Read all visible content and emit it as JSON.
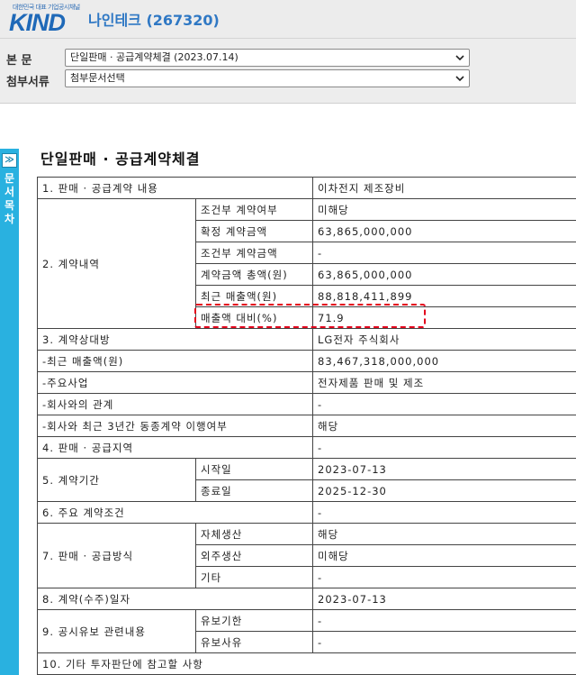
{
  "header": {
    "logo_tagline": "대한민국 대표 기업공시채널",
    "logo_text": "KIND",
    "company": "나인테크 (267320)"
  },
  "selectors": {
    "main_label": "본 문",
    "main_value": "단일판매 · 공급계약체결 (2023.07.14)",
    "attach_label": "첨부서류",
    "attach_value": "첨부문서선택"
  },
  "sidebar": {
    "toggle": "≫",
    "label": "문서목차"
  },
  "doc": {
    "title": "단일판매 · 공급계약체결",
    "r1": {
      "label": "1. 판매 · 공급계약 내용",
      "value": "이차전지 제조장비"
    },
    "r2": {
      "label": "2. 계약내역",
      "items": [
        {
          "label": "조건부 계약여부",
          "value": "미해당"
        },
        {
          "label": "확정 계약금액",
          "value": "63,865,000,000"
        },
        {
          "label": "조건부 계약금액",
          "value": "-"
        },
        {
          "label": "계약금액 총액(원)",
          "value": "63,865,000,000"
        },
        {
          "label": "최근 매출액(원)",
          "value": "88,818,411,899"
        },
        {
          "label": "매출액 대비(%)",
          "value": "71.9"
        }
      ]
    },
    "r3": {
      "label": "3. 계약상대방",
      "value": "LG전자 주식회사"
    },
    "r3a": {
      "label": "-최근 매출액(원)",
      "value": "83,467,318,000,000"
    },
    "r3b": {
      "label": "-주요사업",
      "value": "전자제품 판매 및 제조"
    },
    "r3c": {
      "label": "-회사와의 관계",
      "value": "-"
    },
    "r3d": {
      "label": "-회사와 최근 3년간 동종계약 이행여부",
      "value": "해당"
    },
    "r4": {
      "label": "4. 판매 · 공급지역",
      "value": "-"
    },
    "r5": {
      "label": "5. 계약기간",
      "start_label": "시작일",
      "start_value": "2023-07-13",
      "end_label": "종료일",
      "end_value": "2025-12-30"
    },
    "r6": {
      "label": "6. 주요 계약조건",
      "value": "-"
    },
    "r7": {
      "label": "7. 판매 · 공급방식",
      "items": [
        {
          "label": "자체생산",
          "value": "해당"
        },
        {
          "label": "외주생산",
          "value": "미해당"
        },
        {
          "label": "기타",
          "value": "-"
        }
      ]
    },
    "r8": {
      "label": "8. 계약(수주)일자",
      "value": "2023-07-13"
    },
    "r9": {
      "label": "9. 공시유보 관련내용",
      "items": [
        {
          "label": "유보기한",
          "value": "-"
        },
        {
          "label": "유보사유",
          "value": "-"
        }
      ]
    },
    "r10": {
      "label": "10. 기타 투자판단에 참고할 사항"
    }
  }
}
